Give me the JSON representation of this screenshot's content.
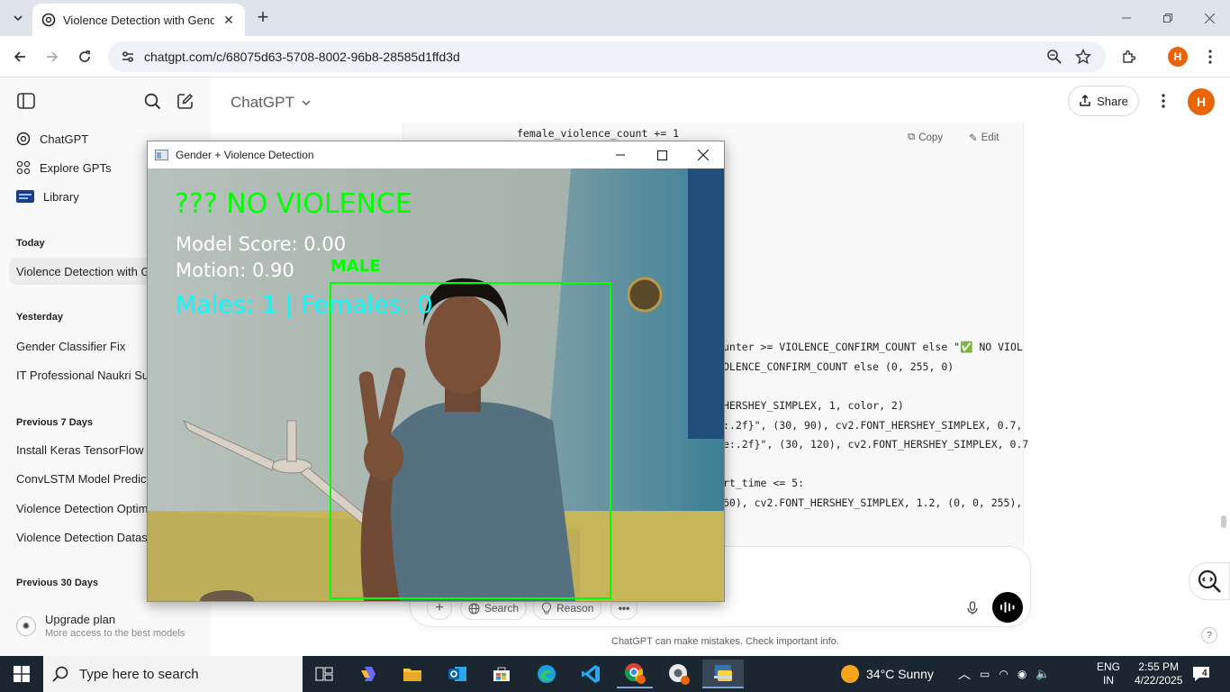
{
  "browser": {
    "tab_title": "Violence Detection with Gender",
    "url": "chatgpt.com/c/68075d63-5708-8002-96b8-28585d1ffd3d",
    "profile_initial": "H"
  },
  "sidebar": {
    "top_items": [
      {
        "label": "ChatGPT",
        "icon": "openai-logo-icon"
      },
      {
        "label": "Explore GPTs",
        "icon": "grid-icon"
      },
      {
        "label": "Library",
        "icon": "library-icon"
      }
    ],
    "sections": [
      {
        "heading": "Today",
        "items": [
          "Violence Detection with Gender"
        ]
      },
      {
        "heading": "Yesterday",
        "items": [
          "Gender Classifier Fix",
          "IT Professional Naukri Summary"
        ]
      },
      {
        "heading": "Previous 7 Days",
        "items": [
          "Install Keras TensorFlow version",
          "ConvLSTM Model Prediction",
          "Violence Detection Optimization",
          "Violence Detection Dataset"
        ]
      },
      {
        "heading": "Previous 30 Days",
        "items": []
      }
    ],
    "upgrade": {
      "title": "Upgrade plan",
      "subtitle": "More access to the best models"
    }
  },
  "main": {
    "model_name": "ChatGPT",
    "share_label": "Share",
    "avatar_initial": "H",
    "code_actions": {
      "copy": "Copy",
      "edit": "Edit"
    },
    "code_lines": [
      "female_violence_count += 1",
      "unter >= VIOLENCE_CONFIRM_COUNT else \"✅ NO VIOL",
      "OLENCE_CONFIRM_COUNT else (0, 255, 0)",
      "HERSHEY_SIMPLEX, 1, color, 2)",
      ":.2f}\", (30, 90), cv2.FONT_HERSHEY_SIMPLEX, 0.7,",
      "e:.2f}\", (30, 120), cv2.FONT_HERSHEY_SIMPLEX, 0.7",
      "rt_time <= 5:",
      "60), cv2.FONT_HERSHEY_SIMPLEX, 1.2, (0, 0, 255),"
    ],
    "composer": {
      "search_label": "Search",
      "reason_label": "Reason"
    },
    "disclaimer": "ChatGPT can make mistakes. Check important info.",
    "help": "?"
  },
  "cv_window": {
    "title": "Gender + Violence Detection",
    "status": "??? NO VIOLENCE",
    "model_score": "Model Score: 0.00",
    "motion": "Motion: 0.90",
    "counts": "Males: 1 | Females: 0",
    "box_label": "MALE",
    "colors": {
      "status": "#00ff00",
      "info": "#ffffff",
      "counts": "#00ffff",
      "box": "#00ff00"
    }
  },
  "taskbar": {
    "search_placeholder": "Type here to search",
    "weather": "34°C  Sunny",
    "lang_top": "ENG",
    "lang_bottom": "IN",
    "time": "2:55 PM",
    "date": "4/22/2025",
    "notifications": "4"
  }
}
